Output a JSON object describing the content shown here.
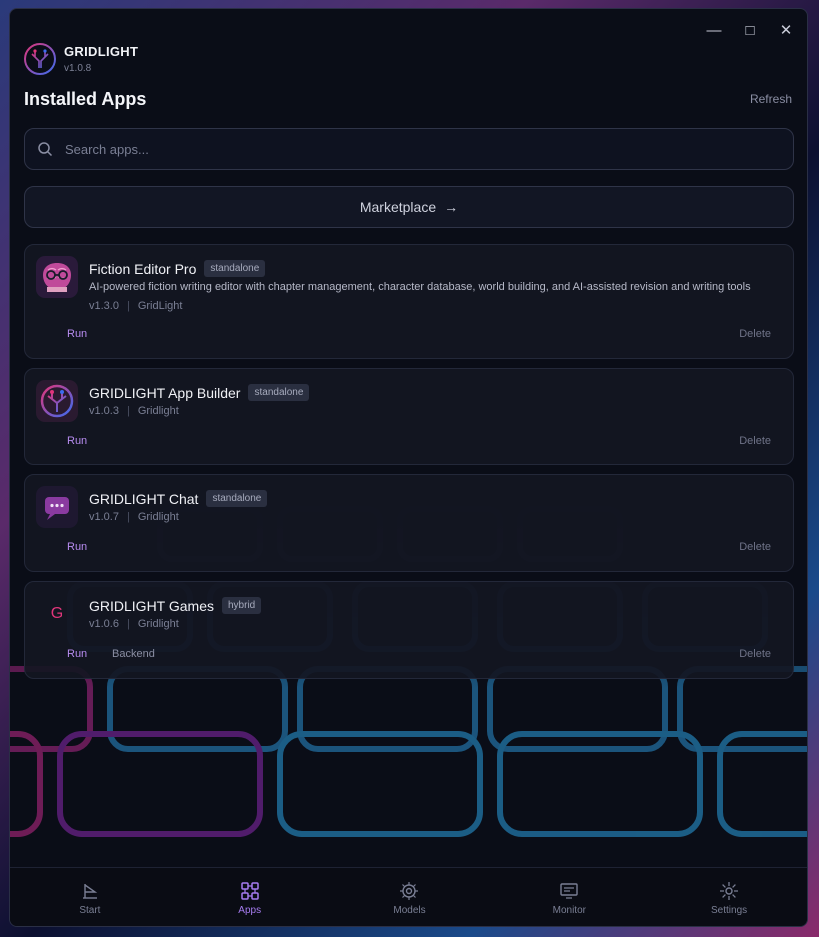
{
  "app": {
    "brand": "GRIDLIGHT",
    "version": "v1.0.8"
  },
  "header": {
    "title": "Installed Apps",
    "refresh": "Refresh"
  },
  "search": {
    "placeholder": "Search apps..."
  },
  "marketplace": {
    "label": "Marketplace"
  },
  "apps": [
    {
      "name": "Fiction Editor Pro",
      "badge": "standalone",
      "description": "AI-powered fiction writing editor with chapter management, character database, world building, and AI-assisted revision and writing tools",
      "version": "v1.3.0",
      "author": "GridLight",
      "run": "Run",
      "delete": "Delete"
    },
    {
      "name": "GRIDLIGHT App Builder",
      "badge": "standalone",
      "version": "v1.0.3",
      "author": "Gridlight",
      "run": "Run",
      "delete": "Delete"
    },
    {
      "name": "GRIDLIGHT Chat",
      "badge": "standalone",
      "version": "v1.0.7",
      "author": "Gridlight",
      "run": "Run",
      "delete": "Delete"
    },
    {
      "name": "GRIDLIGHT Games",
      "badge": "hybrid",
      "icon_letter": "G",
      "version": "v1.0.6",
      "author": "Gridlight",
      "run": "Run",
      "backend": "Backend",
      "delete": "Delete"
    }
  ],
  "nav": {
    "start": "Start",
    "apps": "Apps",
    "models": "Models",
    "monitor": "Monitor",
    "settings": "Settings",
    "active": "apps"
  },
  "colors": {
    "accent": "#a67cf0",
    "brand_pink": "#e0357a",
    "brand_blue": "#3b6cf0"
  }
}
